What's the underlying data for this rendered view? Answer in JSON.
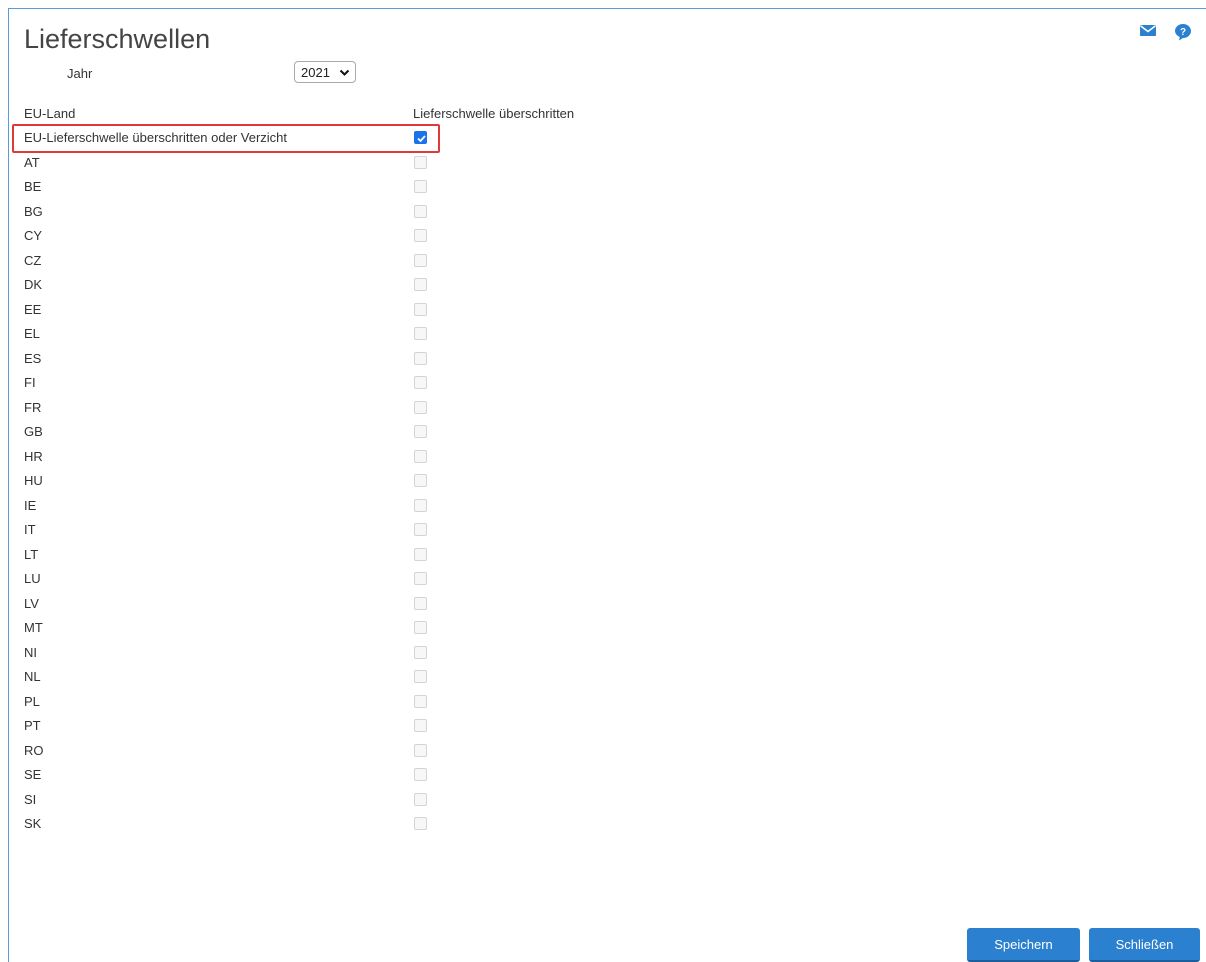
{
  "title": "Lieferschwellen",
  "year": {
    "label": "Jahr",
    "selected": "2021"
  },
  "table": {
    "headers": {
      "country": "EU-Land",
      "threshold": "Lieferschwelle überschritten"
    },
    "rows": [
      {
        "label": "EU-Lieferschwelle überschritten oder Verzicht",
        "checked": true
      },
      {
        "label": "AT",
        "checked": false
      },
      {
        "label": "BE",
        "checked": false
      },
      {
        "label": "BG",
        "checked": false
      },
      {
        "label": "CY",
        "checked": false
      },
      {
        "label": "CZ",
        "checked": false
      },
      {
        "label": "DK",
        "checked": false
      },
      {
        "label": "EE",
        "checked": false
      },
      {
        "label": "EL",
        "checked": false
      },
      {
        "label": "ES",
        "checked": false
      },
      {
        "label": "FI",
        "checked": false
      },
      {
        "label": "FR",
        "checked": false
      },
      {
        "label": "GB",
        "checked": false
      },
      {
        "label": "HR",
        "checked": false
      },
      {
        "label": "HU",
        "checked": false
      },
      {
        "label": "IE",
        "checked": false
      },
      {
        "label": "IT",
        "checked": false
      },
      {
        "label": "LT",
        "checked": false
      },
      {
        "label": "LU",
        "checked": false
      },
      {
        "label": "LV",
        "checked": false
      },
      {
        "label": "MT",
        "checked": false
      },
      {
        "label": "NI",
        "checked": false
      },
      {
        "label": "NL",
        "checked": false
      },
      {
        "label": "PL",
        "checked": false
      },
      {
        "label": "PT",
        "checked": false
      },
      {
        "label": "RO",
        "checked": false
      },
      {
        "label": "SE",
        "checked": false
      },
      {
        "label": "SI",
        "checked": false
      },
      {
        "label": "SK",
        "checked": false
      }
    ]
  },
  "buttons": {
    "save": "Speichern",
    "close": "Schließen"
  },
  "icons": {
    "mail": "mail-icon",
    "help": "help-icon"
  },
  "colors": {
    "accent": "#2b80cf",
    "highlight": "#e0393b",
    "checkbox": "#1a73e8"
  }
}
